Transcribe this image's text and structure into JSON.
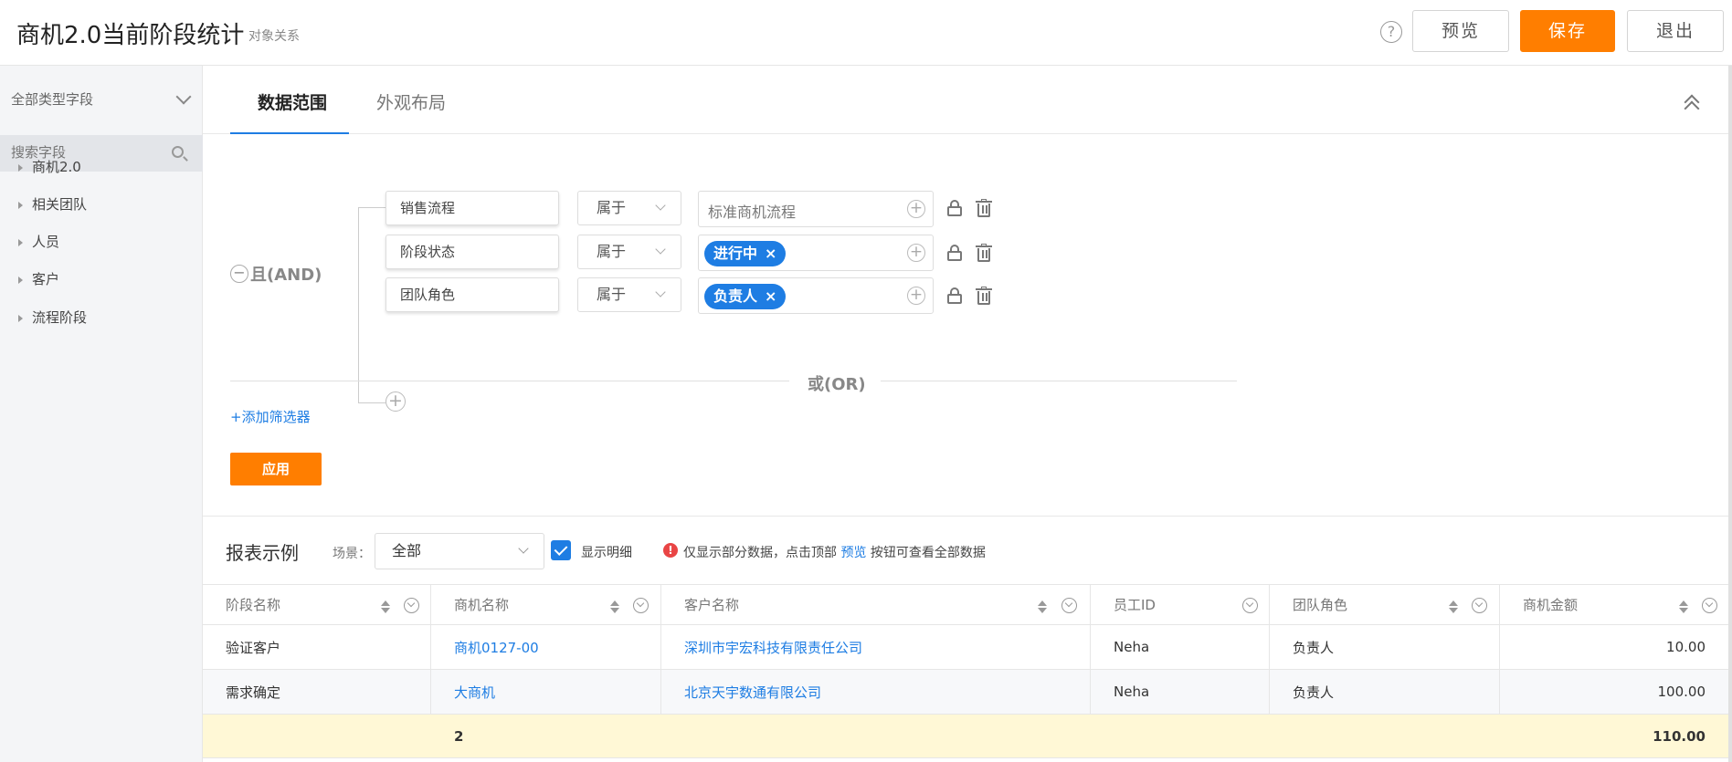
{
  "header": {
    "title": "商机2.0当前阶段统计",
    "subtitle": "对象关系",
    "help_glyph": "?",
    "preview_label": "预览",
    "save_label": "保存",
    "exit_label": "退出"
  },
  "sidebar": {
    "type_select": "全部类型字段",
    "search_placeholder": "搜索字段",
    "items": [
      {
        "label": "商机2.0"
      },
      {
        "label": "相关团队"
      },
      {
        "label": "人员"
      },
      {
        "label": "客户"
      },
      {
        "label": "流程阶段"
      }
    ]
  },
  "tabs": [
    {
      "label": "数据范围",
      "active": true
    },
    {
      "label": "外观布局",
      "active": false
    }
  ],
  "filter": {
    "and_toggle": "−",
    "and_label": "且(AND)",
    "or_label": "或(OR)",
    "add_filter": "+添加筛选器",
    "apply_label": "应用",
    "add_glyph": "+",
    "remove_glyph": "×",
    "conditions": [
      {
        "field": "销售流程",
        "operator": "属于",
        "value_placeholder": "标准商机流程",
        "tag": ""
      },
      {
        "field": "阶段状态",
        "operator": "属于",
        "value_placeholder": "",
        "tag": "进行中"
      },
      {
        "field": "团队角色",
        "operator": "属于",
        "value_placeholder": "",
        "tag": "负责人"
      }
    ]
  },
  "report": {
    "title": "报表示例",
    "scene_label": "场景：",
    "scene_value": "全部",
    "show_detail_label": "显示明细",
    "warn_glyph": "!",
    "notice_prefix": "仅显示部分数据，点击顶部",
    "notice_link": "预览",
    "notice_suffix": "按钮可查看全部数据",
    "columns": [
      "阶段名称",
      "商机名称",
      "客户名称",
      "员工ID",
      "团队角色",
      "商机金额"
    ],
    "rows": [
      [
        "验证客户",
        "商机0127-00",
        "深圳市宇宏科技有限责任公司",
        "Neha",
        "负责人",
        "10.00"
      ],
      [
        "需求确定",
        "大商机",
        "北京天宇数通有限公司",
        "Neha",
        "负责人",
        "100.00"
      ]
    ],
    "total": {
      "count": "2",
      "amount": "110.00"
    }
  },
  "colors": {
    "accent": "#ff7e00",
    "primary": "#1e7de3",
    "total_row_bg": "#fff8d6"
  }
}
